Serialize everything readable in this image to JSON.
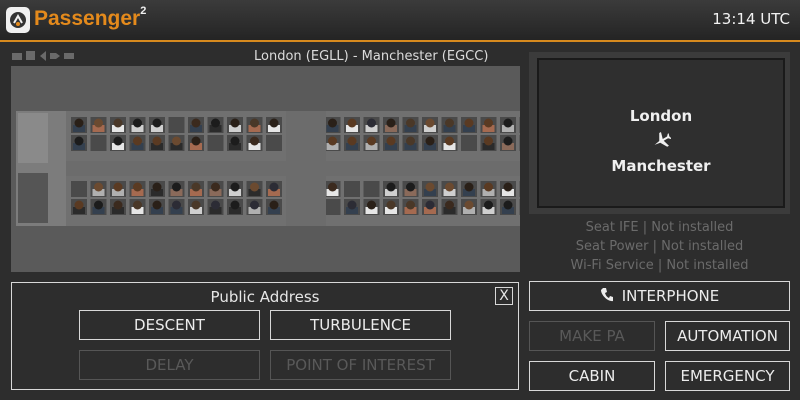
{
  "header": {
    "app_name": "Passenger",
    "app_version_mark": "2",
    "clock": "13:14 UTC",
    "accent_color": "#e48a1c"
  },
  "flight": {
    "route_title": "London (EGLL) - Manchester (EGCC)",
    "origin": "London",
    "destination": "Manchester"
  },
  "services": {
    "seat_ife": "Seat IFE | Not installed",
    "seat_power": "Seat Power | Not installed",
    "wifi": "Wi-Fi Service | Not installed"
  },
  "public_address": {
    "title": "Public Address",
    "close_label": "X",
    "buttons": {
      "descent": "DESCENT",
      "turbulence": "TURBULENCE",
      "delay": "DELAY",
      "point_of_interest": "POINT OF INTEREST"
    }
  },
  "actions": {
    "interphone": "INTERPHONE",
    "make_pa": "MAKE PA",
    "automation": "AUTOMATION",
    "cabin": "CABIN",
    "emergency": "EMERGENCY"
  },
  "icons": {
    "logo": "passenger-logo-icon",
    "phone": "phone-icon",
    "plane": "airplane-icon",
    "minus": "minus-icon"
  }
}
